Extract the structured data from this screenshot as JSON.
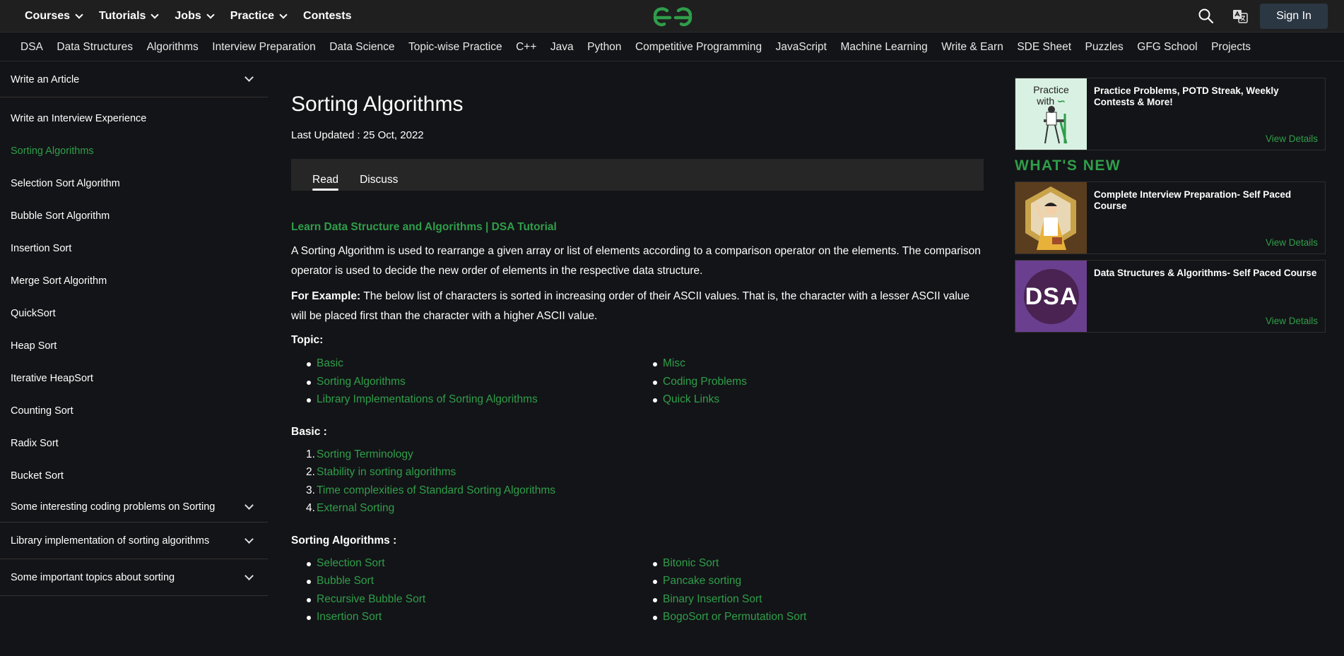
{
  "topnav": [
    {
      "label": "Courses",
      "dropdown": true
    },
    {
      "label": "Tutorials",
      "dropdown": true
    },
    {
      "label": "Jobs",
      "dropdown": true
    },
    {
      "label": "Practice",
      "dropdown": true
    },
    {
      "label": "Contests",
      "dropdown": false
    }
  ],
  "header": {
    "signin_label": "Sign In",
    "brand_color": "#2f9e4a"
  },
  "subnav": [
    "DSA",
    "Data Structures",
    "Algorithms",
    "Interview Preparation",
    "Data Science",
    "Topic-wise Practice",
    "C++",
    "Java",
    "Python",
    "Competitive Programming",
    "JavaScript",
    "Machine Learning",
    "Write & Earn",
    "SDE Sheet",
    "Puzzles",
    "GFG School",
    "Projects"
  ],
  "sidebar": {
    "write_article": "Write an Article",
    "items": [
      "Write an Interview Experience",
      "Sorting Algorithms",
      "Selection Sort Algorithm",
      "Bubble Sort Algorithm",
      "Insertion Sort",
      "Merge Sort Algorithm",
      "QuickSort",
      "Heap Sort",
      "Iterative HeapSort",
      "Counting Sort",
      "Radix Sort",
      "Bucket Sort"
    ],
    "active_item": "Sorting Algorithms",
    "sections": [
      "Some interesting coding problems on Sorting",
      "Library implementation of sorting algorithms",
      "Some important topics about sorting"
    ]
  },
  "article": {
    "title": "Sorting Algorithms",
    "updated": "Last Updated : 25 Oct, 2022",
    "tabs": [
      "Read",
      "Discuss"
    ],
    "lead_link": "Learn Data Structure and Algorithms | DSA Tutorial",
    "intro": "A Sorting Algorithm is used to rearrange a given array or list of elements according to a comparison operator on the elements. The comparison operator is used to decide the new order of elements in the respective data structure.",
    "example_label": "For Example:",
    "example_text": " The below list of characters is sorted in increasing order of their ASCII values. That is, the character with a lesser ASCII value will be placed first than the character with a higher ASCII value.",
    "topic_heading": "Topic:",
    "topics_left": [
      "Basic",
      "Sorting Algorithms",
      "Library Implementations of Sorting Algorithms"
    ],
    "topics_right": [
      "Misc",
      "Coding Problems",
      "Quick Links"
    ],
    "basic_heading": "Basic :",
    "basic_items": [
      "Sorting Terminology",
      "Stability in sorting algorithms",
      "Time complexities of Standard Sorting Algorithms",
      "External Sorting"
    ],
    "algos_heading": "Sorting Algorithms :",
    "algos_left": [
      "Selection Sort",
      "Bubble Sort",
      "Recursive Bubble Sort",
      "Insertion Sort"
    ],
    "algos_right": [
      "Bitonic Sort",
      "Pancake sorting",
      "Binary Insertion Sort",
      "BogoSort or Permutation Sort"
    ]
  },
  "right": {
    "whats_new": "WHAT'S NEW",
    "view_label": "View Details",
    "practice_thumb_line1": "Practice",
    "practice_thumb_line2": "with",
    "cards": [
      {
        "title": "Practice Problems, POTD Streak, Weekly Contests & More!"
      },
      {
        "title": "Complete Interview Preparation- Self Paced Course"
      },
      {
        "title": "Data Structures & Algorithms- Self Paced Course",
        "thumb_text": "DSA"
      }
    ]
  }
}
